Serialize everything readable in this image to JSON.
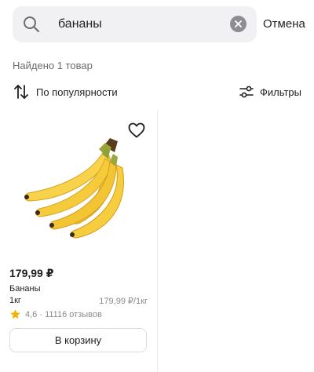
{
  "search": {
    "value": "бананы",
    "cancel_label": "Отмена"
  },
  "results": {
    "found_text": "Найдено 1 товар"
  },
  "toolbar": {
    "sort_label": "По популярности",
    "filter_label": "Фильтры"
  },
  "products": [
    {
      "price": "179,99 ₽",
      "name": "Бананы",
      "weight": "1кг",
      "unit_price": "179,99 ₽/1кг",
      "rating_text": "4,6 · 11116 отзывов",
      "cart_label": "В корзину",
      "favorite_icon": "heart-outline-icon",
      "rating_icon": "star-icon"
    }
  ],
  "colors": {
    "search_bg": "#f1f1f3",
    "clear_bg": "#8d8d93",
    "star": "#f5b301",
    "muted_text": "#8a8a8f"
  }
}
